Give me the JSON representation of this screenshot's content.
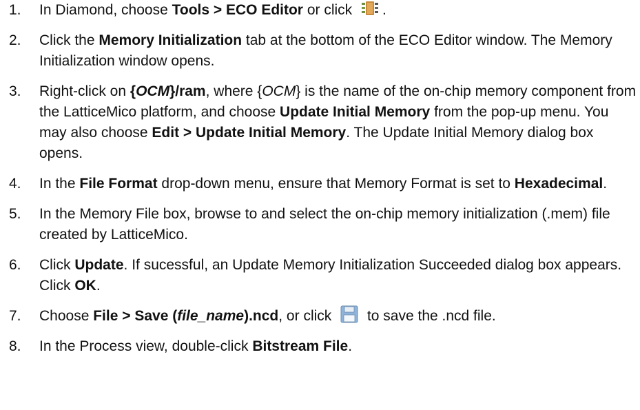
{
  "steps": [
    {
      "num": "1.",
      "parts": [
        {
          "t": "In Diamond, choose "
        },
        {
          "t": "Tools > ECO Editor",
          "b": true
        },
        {
          "t": " or click "
        },
        {
          "icon": "eco-editor-icon"
        },
        {
          "t": "."
        }
      ]
    },
    {
      "num": "2.",
      "parts": [
        {
          "t": "Click the "
        },
        {
          "t": "Memory Initialization",
          "b": true
        },
        {
          "t": " tab at the bottom of the ECO Editor window. The Memory Initialization window opens."
        }
      ]
    },
    {
      "num": "3.",
      "parts": [
        {
          "t": "Right-click on "
        },
        {
          "t": "{",
          "b": true
        },
        {
          "t": "OCM",
          "b": true,
          "i": true
        },
        {
          "t": "}/ram",
          "b": true
        },
        {
          "t": ", where {"
        },
        {
          "t": "OCM",
          "i": true
        },
        {
          "t": "} is the name of the on-chip memory component from the LatticeMico platform, and choose "
        },
        {
          "t": "Update Initial Memory",
          "b": true
        },
        {
          "t": " from the pop-up menu. You may also choose "
        },
        {
          "t": "Edit > Update Initial Memory",
          "b": true
        },
        {
          "t": ". The Update Initial Memory dialog box opens."
        }
      ]
    },
    {
      "num": "4.",
      "parts": [
        {
          "t": "In the "
        },
        {
          "t": "File Format",
          "b": true
        },
        {
          "t": " drop-down menu, ensure that Memory Format is set to "
        },
        {
          "t": "Hexadecimal",
          "b": true
        },
        {
          "t": "."
        }
      ]
    },
    {
      "num": "5.",
      "parts": [
        {
          "t": "In the Memory File box, browse to and select the on-chip memory initialization (.mem) file created by LatticeMico."
        }
      ]
    },
    {
      "num": "6.",
      "parts": [
        {
          "t": "Click "
        },
        {
          "t": "Update",
          "b": true
        },
        {
          "t": ". If sucessful, an Update Memory Initialization Succeeded dialog box appears. Click "
        },
        {
          "t": "OK",
          "b": true
        },
        {
          "t": "."
        }
      ]
    },
    {
      "num": "7.",
      "parts": [
        {
          "t": "Choose "
        },
        {
          "t": "File > Save (",
          "b": true
        },
        {
          "t": "file_name",
          "b": true,
          "i": true
        },
        {
          "t": ").ncd",
          "b": true
        },
        {
          "t": ", or click "
        },
        {
          "icon": "save-icon"
        },
        {
          "t": " to save the .ncd file."
        }
      ]
    },
    {
      "num": "8.",
      "parts": [
        {
          "t": "In the Process view, double-click "
        },
        {
          "t": "Bitstream File",
          "b": true
        },
        {
          "t": "."
        }
      ]
    }
  ]
}
